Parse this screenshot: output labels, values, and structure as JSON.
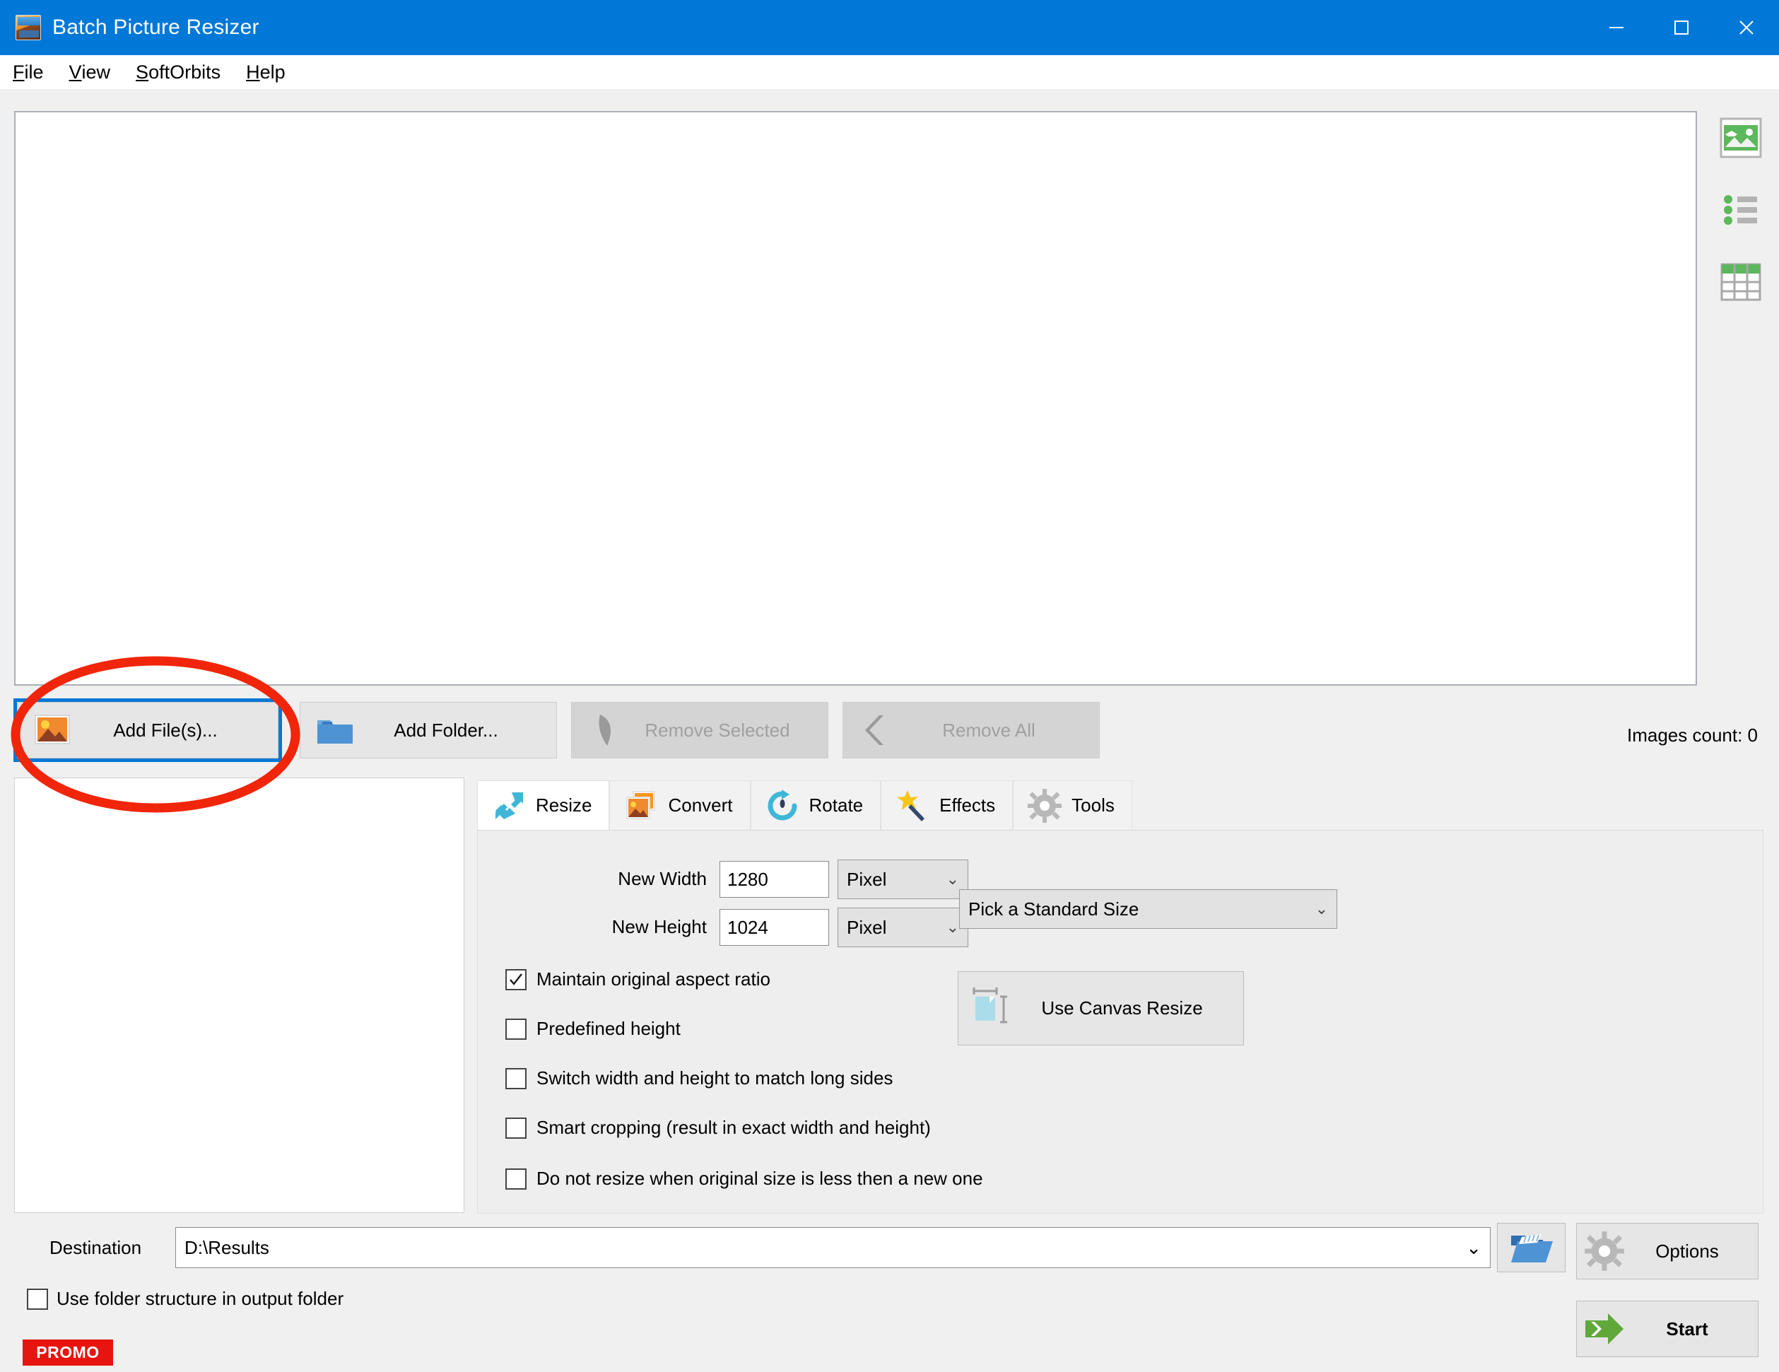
{
  "window": {
    "title": "Batch Picture Resizer",
    "app_icon": "picture-icon",
    "controls": {
      "minimize": "—",
      "maximize": "□",
      "close": "✕"
    },
    "titlebar_color": "#0078d7"
  },
  "menubar": {
    "items": [
      {
        "label": "File",
        "accel": "F",
        "rest": "ile"
      },
      {
        "label": "View",
        "accel": "V",
        "rest": "iew"
      },
      {
        "label": "SoftOrbits",
        "accel": "S",
        "rest": "oftOrbits"
      },
      {
        "label": "Help",
        "accel": "H",
        "rest": "elp"
      }
    ]
  },
  "preview": {
    "empty": true
  },
  "view_modes": [
    {
      "name": "thumbnail-view",
      "icon": "image-thumbnail-icon"
    },
    {
      "name": "list-view",
      "icon": "bullet-list-icon"
    },
    {
      "name": "details-view",
      "icon": "table-grid-icon"
    }
  ],
  "toolbar": {
    "add_files": {
      "label": "Add File(s)...",
      "accel_index": 6,
      "icon": "picture-icon",
      "focused": true,
      "disabled": false
    },
    "add_folder": {
      "label": "Add Folder...",
      "accel_index": 6,
      "icon": "folder-icon",
      "disabled": false
    },
    "remove_selected": {
      "label": "Remove Selected",
      "icon": "remove-icon",
      "disabled": true
    },
    "remove_all": {
      "label": "Remove All",
      "icon": "chevron-left-icon",
      "disabled": true
    },
    "images_count": "Images count: 0"
  },
  "tabs": [
    {
      "label": "Resize",
      "icon": "resize-arrows-icon",
      "active": true
    },
    {
      "label": "Convert",
      "icon": "convert-images-icon",
      "active": false
    },
    {
      "label": "Rotate",
      "icon": "rotate-circular-icon",
      "active": false
    },
    {
      "label": "Effects",
      "icon": "magic-wand-icon",
      "active": false
    },
    {
      "label": "Tools",
      "icon": "gear-icon",
      "active": false
    }
  ],
  "resize_panel": {
    "new_width_label": "New Width",
    "new_width_value": "1280",
    "width_unit": "Pixel",
    "new_height_label": "New Height",
    "new_height_value": "1024",
    "height_unit": "Pixel",
    "standard_size": "Pick a Standard Size",
    "canvas_resize_button": "Use Canvas Resize",
    "canvas_resize_icon": "canvas-measure-icon",
    "checkboxes": [
      {
        "label": "Maintain original aspect ratio",
        "checked": true
      },
      {
        "label": "Predefined height",
        "checked": false
      },
      {
        "label": "Switch width and height to match long sides",
        "checked": false
      },
      {
        "label": "Smart cropping (result in exact width and height)",
        "checked": false
      },
      {
        "label": "Do not resize when original size is less then a new one",
        "checked": false
      }
    ]
  },
  "bottom": {
    "destination_label": "Destination",
    "destination_value": "D:\\Results",
    "browse_icon": "open-folder-icon",
    "use_folder_structure": {
      "label": "Use folder structure in output folder",
      "checked": false
    },
    "promo_badge": "PROMO",
    "options_button": "Options",
    "options_icon": "gear-icon",
    "start_button": "Start",
    "start_icon": "green-arrow-icon"
  },
  "annotation": {
    "shape": "ellipse",
    "color": "#f1250a",
    "target": "add-files-button"
  }
}
